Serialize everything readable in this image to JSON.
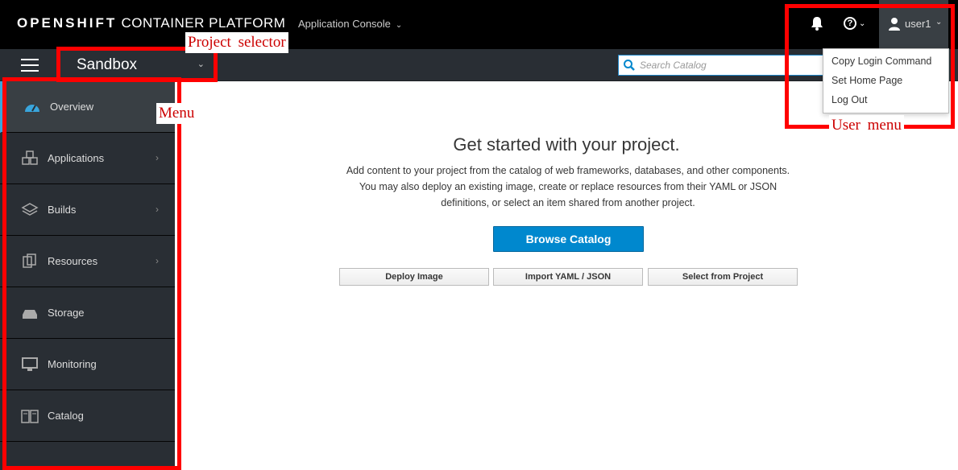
{
  "header": {
    "brand_bold": "OPENSHIFT",
    "brand_rest": "CONTAINER PLATFORM",
    "app_console_label": "Application Console",
    "user_label": "user1"
  },
  "project_selector": {
    "value": "Sandbox"
  },
  "search": {
    "placeholder": "Search Catalog"
  },
  "sidebar": {
    "items": [
      {
        "label": "Overview",
        "icon": "dashboard-icon",
        "has_submenu": false,
        "active": true
      },
      {
        "label": "Applications",
        "icon": "cubes-icon",
        "has_submenu": true,
        "active": false
      },
      {
        "label": "Builds",
        "icon": "layers-icon",
        "has_submenu": true,
        "active": false
      },
      {
        "label": "Resources",
        "icon": "copy-icon",
        "has_submenu": true,
        "active": false
      },
      {
        "label": "Storage",
        "icon": "storage-icon",
        "has_submenu": false,
        "active": false
      },
      {
        "label": "Monitoring",
        "icon": "monitor-icon",
        "has_submenu": false,
        "active": false
      },
      {
        "label": "Catalog",
        "icon": "book-icon",
        "has_submenu": false,
        "active": false
      }
    ]
  },
  "main": {
    "headline": "Get started with your project.",
    "description": "Add content to your project from the catalog of web frameworks, databases, and other components. You may also deploy an existing image, create or replace resources from their YAML or JSON definitions, or select an item shared from another project.",
    "primary_button": "Browse Catalog",
    "secondary_buttons": [
      "Deploy Image",
      "Import YAML / JSON",
      "Select from Project"
    ]
  },
  "user_menu": {
    "items": [
      "Copy Login Command",
      "Set Home Page",
      "Log Out"
    ]
  },
  "annotations": {
    "project_selector": "Project selector",
    "menu": "Menu",
    "user_menu": "User menu"
  },
  "colors": {
    "topbar": "#000000",
    "sidebar": "#292e34",
    "primary": "#0088ce",
    "annotation": "#ff0000"
  }
}
